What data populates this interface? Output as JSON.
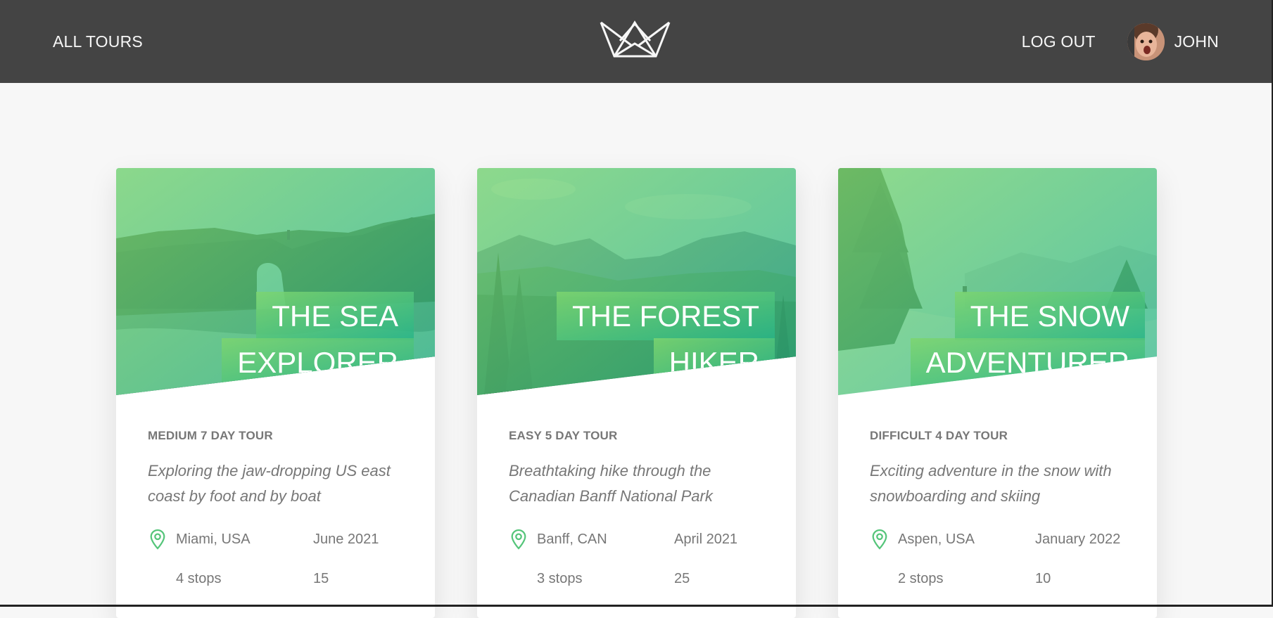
{
  "header": {
    "all_tours": "All tours",
    "logout": "Log out",
    "user_name": "John",
    "logo_icon": "crown-logo-icon"
  },
  "colors": {
    "header_bg": "#444444",
    "accent_light": "#7dd56f",
    "accent_dark": "#28b487",
    "page_bg": "#f7f7f7"
  },
  "tours": [
    {
      "title_line1": "The Sea",
      "title_line2": "Explorer",
      "sub_heading": "Medium 7 day tour",
      "summary": "Exploring the jaw-dropping US east coast by foot and by boat",
      "location": "Miami, USA",
      "date": "June 2021",
      "stops": "4 stops",
      "group_size": "15",
      "location_icon": "map-pin-icon"
    },
    {
      "title_line1": "The Forest",
      "title_line2": "Hiker",
      "sub_heading": "Easy 5 day tour",
      "summary": "Breathtaking hike through the Canadian Banff National Park",
      "location": "Banff, CAN",
      "date": "April 2021",
      "stops": "3 stops",
      "group_size": "25",
      "location_icon": "map-pin-icon"
    },
    {
      "title_line1": "The Snow",
      "title_line2": "Adventurer",
      "sub_heading": "Difficult 4 day tour",
      "summary": "Exciting adventure in the snow with snowboarding and skiing",
      "location": "Aspen, USA",
      "date": "January 2022",
      "stops": "2 stops",
      "group_size": "10",
      "location_icon": "map-pin-icon"
    }
  ]
}
